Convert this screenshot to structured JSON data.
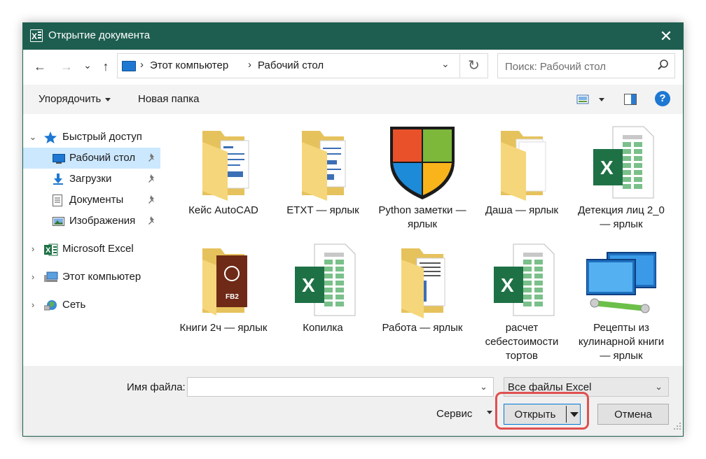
{
  "window": {
    "title": "Открытие документа",
    "close_glyph": "✕",
    "accent": "#1e5e50"
  },
  "nav": {
    "back_glyph": "←",
    "forward_glyph": "→",
    "recent_glyph": "⌄",
    "up_glyph": "↑",
    "refresh_glyph": "↻",
    "dropdown_glyph": "⌄"
  },
  "address": {
    "sep": "›",
    "crumbs": [
      "Этот компьютер",
      "Рабочий стол"
    ]
  },
  "search": {
    "placeholder": "Поиск: Рабочий стол"
  },
  "toolbar": {
    "organize": "Упорядочить",
    "new_folder": "Новая папка",
    "help_glyph": "?"
  },
  "sidebar": {
    "expand_glyph": "⌄",
    "collapsed_glyph": "›",
    "items": [
      {
        "label": "Быстрый доступ",
        "icon": "star-icon"
      },
      {
        "label": "Рабочий стол",
        "icon": "desktop-icon",
        "pinned": true,
        "selected": true
      },
      {
        "label": "Загрузки",
        "icon": "download-icon",
        "pinned": true
      },
      {
        "label": "Документы",
        "icon": "documents-icon",
        "pinned": true
      },
      {
        "label": "Изображения",
        "icon": "pictures-icon",
        "pinned": true
      },
      {
        "label": "Microsoft Excel",
        "icon": "excel-icon"
      },
      {
        "label": "Этот компьютер",
        "icon": "computer-icon"
      },
      {
        "label": "Сеть",
        "icon": "network-icon"
      }
    ]
  },
  "files": [
    {
      "name": "Кейс AutoCAD",
      "icon": "folder-icon"
    },
    {
      "name": "ETXT — ярлык",
      "icon": "folder-shortcut-icon"
    },
    {
      "name": "Python заметки — ярлык",
      "icon": "shield-icon"
    },
    {
      "name": "Даша — ярлык",
      "icon": "folder-shortcut-icon"
    },
    {
      "name": "Детекция лиц 2_0 — ярлык",
      "icon": "excel-file-icon"
    },
    {
      "name": "Книги 2ч — ярлык",
      "icon": "fb2-folder-icon"
    },
    {
      "name": "Копилка",
      "icon": "excel-file-icon"
    },
    {
      "name": "Работа — ярлык",
      "icon": "folder-shortcut-icon"
    },
    {
      "name": "расчет себестоимости тортов",
      "icon": "excel-file-icon"
    },
    {
      "name": "Рецепты из кулинарной книги — ярлык",
      "icon": "network-monitors-icon"
    }
  ],
  "footer": {
    "filename_label": "Имя файла:",
    "filename_value": "",
    "filter": "Все файлы Excel",
    "service": "Сервис",
    "open": "Открыть",
    "cancel": "Отмена",
    "dropdown_glyph": "⌄"
  }
}
